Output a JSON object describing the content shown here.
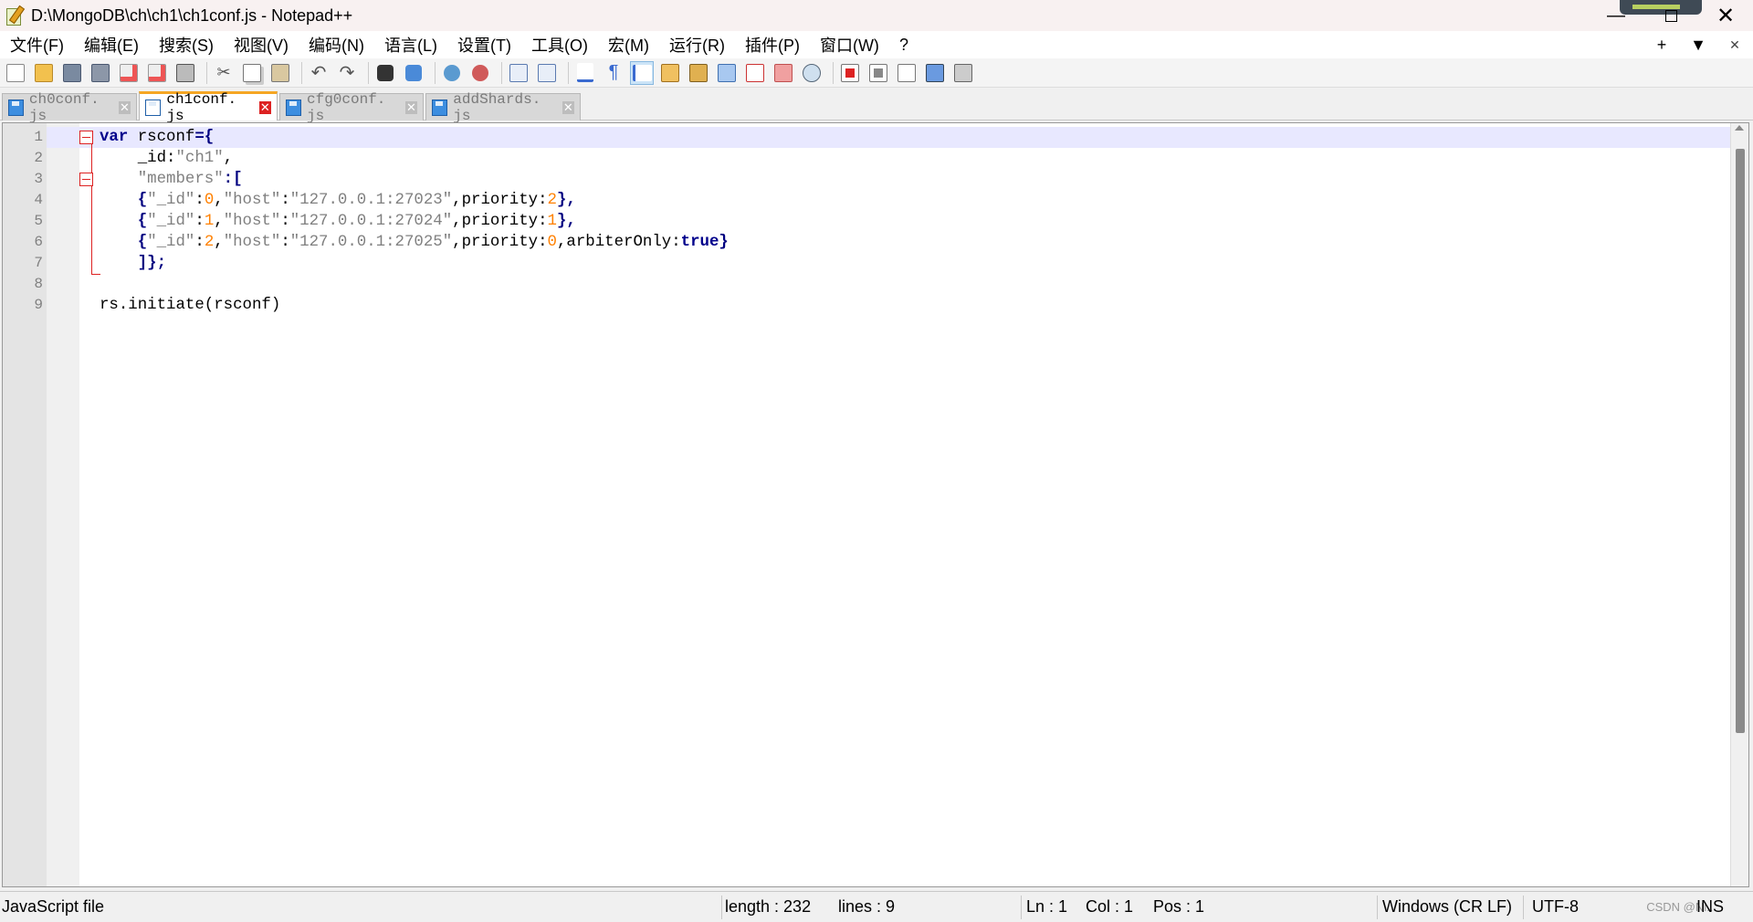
{
  "window": {
    "title": "D:\\MongoDB\\ch\\ch1\\ch1conf.js - Notepad++",
    "minimize_glyph": "—",
    "close_glyph": "✕"
  },
  "menu": {
    "items": [
      "文件(F)",
      "编辑(E)",
      "搜索(S)",
      "视图(V)",
      "编码(N)",
      "语言(L)",
      "设置(T)",
      "工具(O)",
      "宏(M)",
      "运行(R)",
      "插件(P)",
      "窗口(W)",
      "?"
    ],
    "right": [
      "+",
      "▼",
      "✕"
    ]
  },
  "toolbar": {
    "icons": [
      "new-file-icon",
      "open-file-icon",
      "save-icon",
      "save-all-icon",
      "close-icon",
      "close-all-icon",
      "print-icon",
      "cut-icon",
      "copy-icon",
      "paste-icon",
      "undo-icon",
      "redo-icon",
      "find-icon",
      "replace-icon",
      "zoom-in-icon",
      "zoom-out-icon",
      "sync-vertical-icon",
      "sync-horizontal-icon",
      "word-wrap-icon",
      "show-all-chars-icon",
      "indent-guide-icon",
      "udl-icon",
      "doc-map-icon",
      "doc-list-icon",
      "function-list-icon",
      "folder-as-workspace-icon",
      "monitoring-icon",
      "record-macro-icon",
      "stop-record-icon",
      "play-macro-icon",
      "run-macro-multiple-icon",
      "save-macro-icon"
    ]
  },
  "tabs": [
    {
      "label": "ch0conf. js",
      "active": false
    },
    {
      "label": "ch1conf. js",
      "active": true
    },
    {
      "label": "cfg0conf. js",
      "active": false
    },
    {
      "label": "addShards. js",
      "active": false
    }
  ],
  "editor": {
    "line_numbers": [
      "1",
      "2",
      "3",
      "4",
      "5",
      "6",
      "7",
      "8",
      "9"
    ],
    "code": {
      "l1_kw": "var",
      "l1_rest": " rsconf",
      "l1_op": "={",
      "l2_a": "    _id:",
      "l2_s": "\"ch1\"",
      "l2_c": ",",
      "l3_s": "    \"members\"",
      "l3_op": ":[",
      "l4_a": "    {",
      "l4_s1": "\"_id\"",
      "l4_c1": ":",
      "l4_n1": "0",
      "l4_c2": ",",
      "l4_s2": "\"host\"",
      "l4_c3": ":",
      "l4_s3": "\"127.0.0.1:27023\"",
      "l4_t": ",priority:",
      "l4_n2": "2",
      "l4_e": "},",
      "l5_n1": "1",
      "l5_s3": "\"127.0.0.1:27024\"",
      "l5_n2": "1",
      "l6_n1": "2",
      "l6_s3": "\"127.0.0.1:27025\"",
      "l6_n2": "0",
      "l6_t2": ",arbiterOnly:",
      "l6_kw": "true",
      "l6_e": "}",
      "l7": "    ]};",
      "l9": "rs.initiate(rsconf)"
    }
  },
  "status": {
    "file_type": "JavaScript file",
    "length": "length : 232",
    "lines": "lines : 9",
    "ln": "Ln : 1",
    "col": "Col : 1",
    "pos": "Pos : 1",
    "eol": "Windows (CR LF)",
    "encoding": "UTF-8",
    "mode": "INS",
    "watermark": "CSDN @Ni..."
  }
}
